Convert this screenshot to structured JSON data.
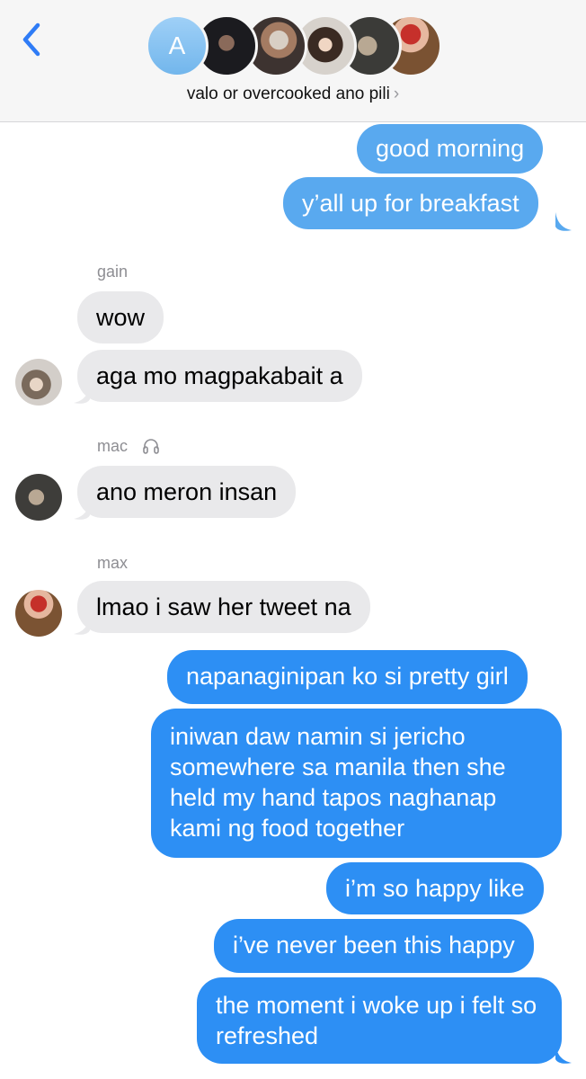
{
  "header": {
    "avatar_letter": "A",
    "group_name": "valo or overcooked ano pili",
    "chevron": "›"
  },
  "colors": {
    "outgoing_light": "#59a9ef",
    "outgoing_dark": "#2d8ff4",
    "incoming": "#e9e9eb",
    "back_arrow": "#2f7cf6"
  },
  "messages": {
    "m1": "good morning",
    "m2": "y’all up for breakfast",
    "gain_name": "gain",
    "m3": "wow",
    "m4": "aga mo magpakabait a",
    "mac_name": "mac",
    "m5": "ano meron insan",
    "max_name": "max",
    "m6": "lmao i saw her tweet na",
    "m7": "napanaginipan ko si pretty girl",
    "m8": "iniwan daw namin si jericho somewhere sa manila then she held my hand tapos naghanap kami ng food together",
    "m9": "i’m so happy like",
    "m10": "i’ve never been this happy",
    "m11": "the moment i woke up i felt so refreshed"
  },
  "icons": {
    "back": "chevron-left-icon",
    "headphones": "headphones-icon"
  }
}
